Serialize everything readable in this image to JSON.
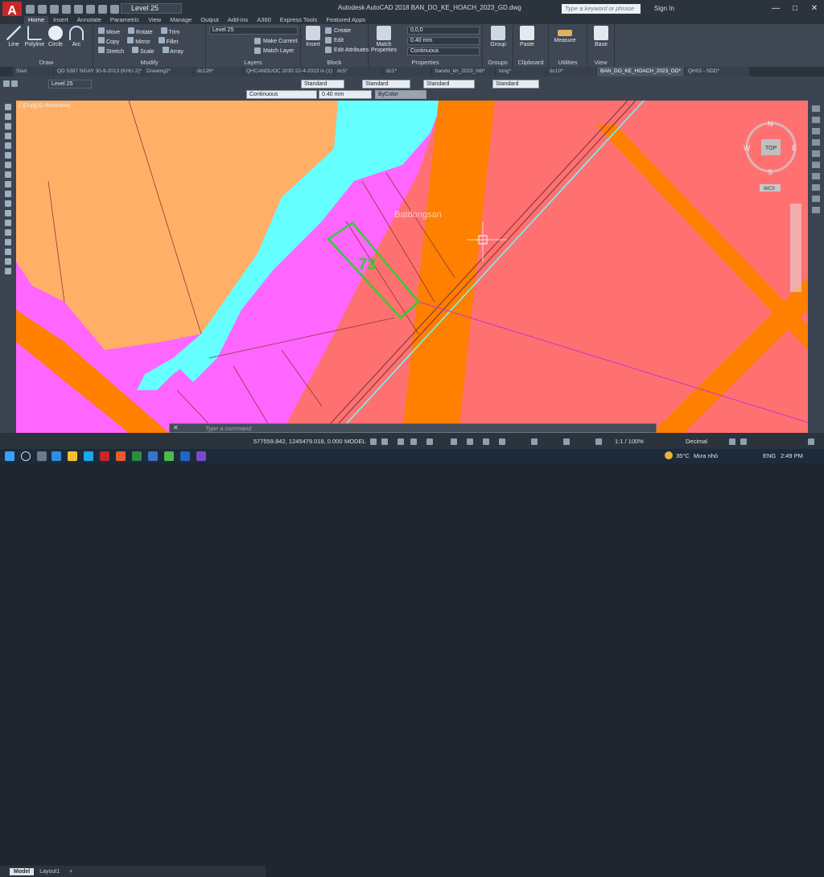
{
  "app": {
    "logo_letter": "A",
    "title": "Autodesk AutoCAD 2018    BAN_DO_KE_HOACH_2023_GD.dwg",
    "search_placeholder": "Type a keyword or phrase",
    "signin": "Sign In",
    "qat_layer": "Level 25"
  },
  "ribbon_tabs": [
    "Home",
    "Insert",
    "Annotate",
    "Parametric",
    "View",
    "Manage",
    "Output",
    "Add-ins",
    "A360",
    "Express Tools",
    "Featured Apps"
  ],
  "ribbon": {
    "draw": {
      "title": "Draw",
      "tools": [
        "Line",
        "Polyline",
        "Circle",
        "Arc"
      ]
    },
    "modify": {
      "title": "Modify",
      "rows": [
        [
          "Move",
          "Rotate",
          "Trim"
        ],
        [
          "Copy",
          "Mirror",
          "Fillet"
        ],
        [
          "Stretch",
          "Scale",
          "Array"
        ]
      ]
    },
    "layers": {
      "title": "Layers",
      "combo": "Level 25",
      "buttons": [
        "Make Current",
        "Match Layer"
      ]
    },
    "block": {
      "title": "Block",
      "insert": "Insert",
      "buttons": [
        "Create",
        "Edit",
        "Edit Attributes"
      ]
    },
    "properties": {
      "title": "Properties",
      "match": "Match Properties",
      "color": "0,0,0",
      "lineweight": "0.40 mm",
      "linetype": "Continuous"
    },
    "groups": {
      "title": "Groups",
      "label": "Group"
    },
    "clipboard": {
      "title": "Clipboard",
      "label": "Paste"
    },
    "utilities": {
      "title": "Utilities",
      "label": "Measure"
    },
    "view": {
      "title": "View",
      "label": "Base"
    }
  },
  "file_tabs": [
    "Start",
    "QD 5387 NGAY 30-9-2013 (KHU 2)*",
    "Drawing2*",
    "dc126*",
    "QHCANDUOC 2030 22-4-2023 in (1)*",
    "dc5*",
    "dc1*",
    "bando_kh_2023_htb*",
    "tong*",
    "dc10*",
    "BAN_DO_KE_HOACH_2023_GD*",
    "QH03 - SDD*"
  ],
  "active_file_tab": "BAN_DO_KE_HOACH_2023_GD*",
  "toolbar2": {
    "layer": "Level 25",
    "styles": [
      "Standard",
      "Standard",
      "Standard",
      "Standard"
    ],
    "linetype": "Continuous",
    "lineweight": "0.40 mm",
    "plotstyle": "ByColor"
  },
  "viewport": {
    "label": "[-][Top][2D Wireframe]",
    "parcel_number": "73",
    "watermark": "Batdongsan",
    "viewcube": {
      "top": "TOP",
      "n": "N",
      "s": "S",
      "e": "E",
      "w": "W",
      "wcs": "WCS"
    }
  },
  "colors": {
    "pink": "#ff7171",
    "magenta": "#ff66ff",
    "tan": "#ffb066",
    "cyan": "#66ffff",
    "orange": "#ff7f00",
    "green_outline": "#33cc33"
  },
  "command_line": {
    "placeholder": "Type a command"
  },
  "layout_tabs": [
    "Model",
    "Layout1",
    "+"
  ],
  "status": {
    "coords": "577559.842, 1245479.018, 0.000",
    "model": "MODEL",
    "scale": "1:1 / 100%",
    "units": "Decimal"
  },
  "taskbar": {
    "temperature": "35°C",
    "weather": "Mưa nhỏ",
    "lang": "ENG",
    "time": "2:49 PM"
  }
}
